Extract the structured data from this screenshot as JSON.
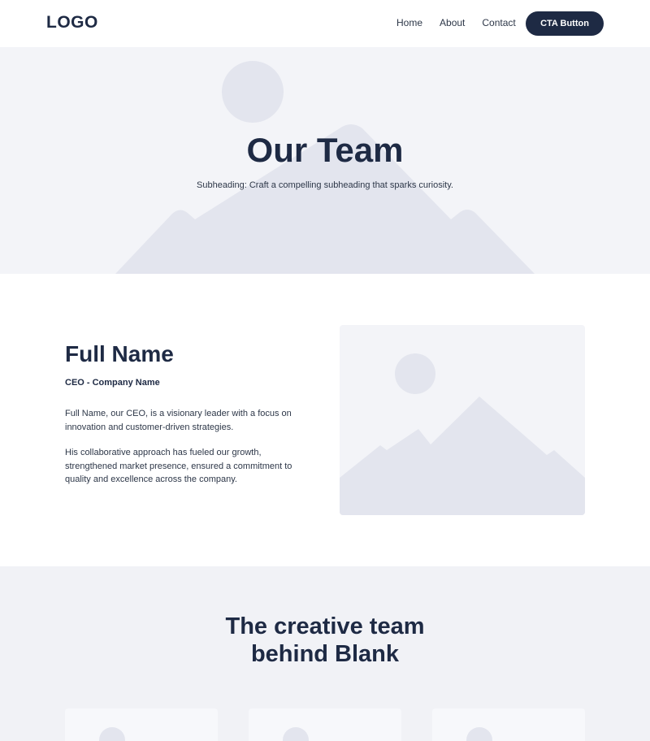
{
  "header": {
    "logo": "LOGO",
    "nav": [
      "Home",
      "About",
      "Contact"
    ],
    "cta_label": "CTA Button"
  },
  "hero": {
    "title": "Our Team",
    "subtitle": "Subheading: Craft a compelling subheading that sparks curiosity."
  },
  "profile": {
    "name": "Full Name",
    "role": "CEO - Company Name",
    "paragraph1": "Full Name, our CEO, is a visionary leader with a focus on innovation and customer-driven strategies.",
    "paragraph2": "His collaborative approach has fueled our growth, strengthened market presence, ensured a commitment to quality and excellence across the company."
  },
  "team": {
    "title_line1": "The creative team",
    "title_line2": "behind Blank"
  },
  "colors": {
    "primary": "#1e2a44",
    "placeholder_bg": "#f3f4f8",
    "placeholder_shape": "#e3e5ee"
  }
}
